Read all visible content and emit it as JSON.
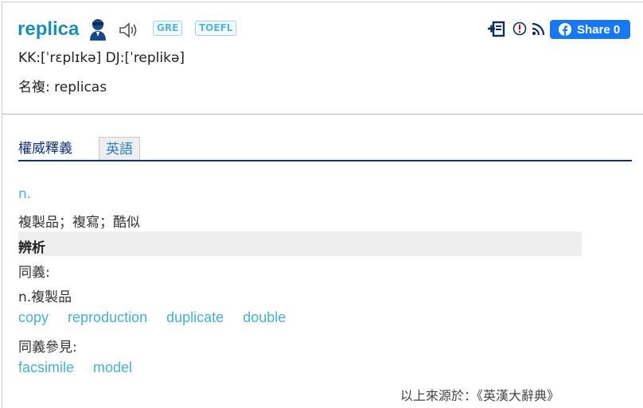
{
  "header": {
    "word": "replica",
    "badges": {
      "gre": "GRE",
      "toefl": "TOEFL"
    },
    "pronunciation": "KK:[ˈrɛplɪkə] DJ:[ˈreplikə]",
    "plural": "名複: replicas",
    "share": {
      "label": "Share",
      "count": "0",
      "color": "#1877f2"
    }
  },
  "tabs": {
    "active": "權威釋義",
    "english": "英語"
  },
  "entry": {
    "pos": "n.",
    "definition": "複製品；複寫；酷似",
    "analysis_heading": "辨析",
    "synonyms_label": "同義:",
    "synonyms_pos": "n.複製品",
    "synonyms": [
      "copy",
      "reproduction",
      "duplicate",
      "double"
    ],
    "see_also_label": "同義參見:",
    "see_also": [
      "facsimile",
      "model"
    ],
    "source": "以上來源於：《英漢大辭典》"
  },
  "colors": {
    "word": "#1a8fb5",
    "link": "#4ab0c7",
    "tab_line": "#10307a"
  }
}
